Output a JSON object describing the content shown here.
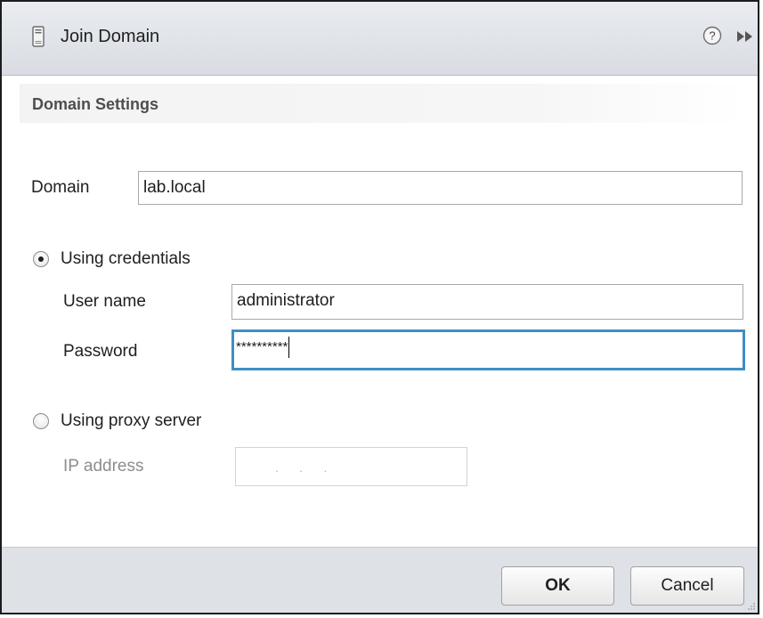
{
  "dialog": {
    "title": "Join Domain",
    "title_icon": "host-device-icon",
    "help_icon": "help-icon",
    "expand_icon": "double-chevron-right-icon"
  },
  "section": {
    "title": "Domain Settings"
  },
  "domain": {
    "label": "Domain",
    "value": "lab.local"
  },
  "credentials": {
    "option_label": "Using credentials",
    "selected": true,
    "username_label": "User name",
    "username_value": "administrator",
    "password_label": "Password",
    "password_value": "**********"
  },
  "proxy": {
    "option_label": "Using proxy server",
    "selected": false,
    "ip_label": "IP address",
    "ip_value": ".      .      ."
  },
  "buttons": {
    "ok": "OK",
    "cancel": "Cancel"
  },
  "colors": {
    "focus_border": "#3f8fc4",
    "titlebar": "#dfe2e7",
    "footer": "#dee1e5"
  }
}
